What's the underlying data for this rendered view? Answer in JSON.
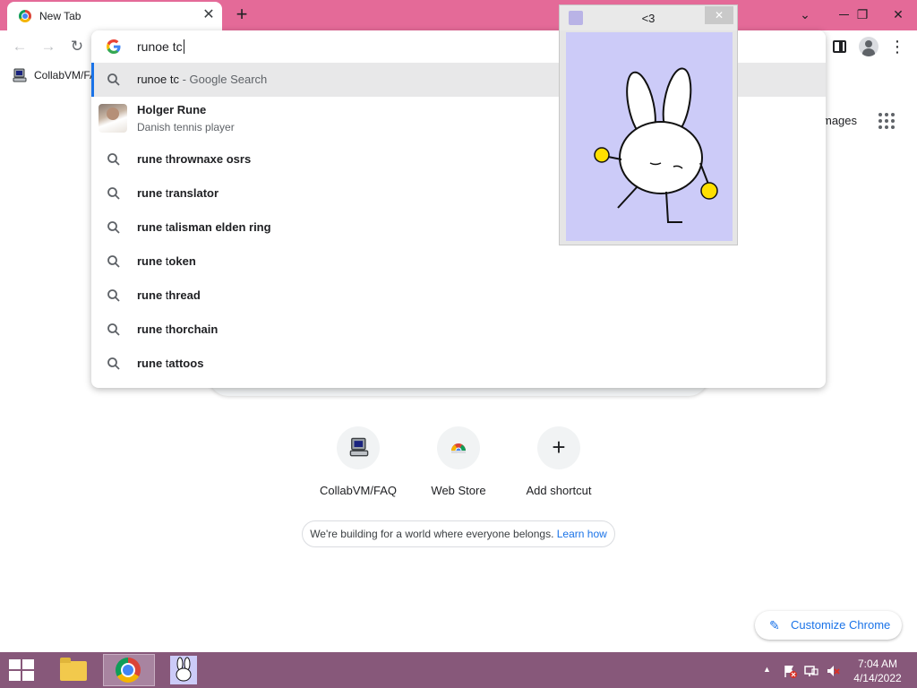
{
  "tab": {
    "title": "New Tab",
    "close_glyph": "✕",
    "new_tab_glyph": "+"
  },
  "window_controls": {
    "minimize": "⌄",
    "restore": "❐",
    "close": "✕"
  },
  "toolbar": {
    "back": "←",
    "forward": "→",
    "reload": "↻",
    "menu": "⋮"
  },
  "bookmarks": [
    {
      "label": "CollabVM/FAQ",
      "icon": "collabvm-computer-icon"
    }
  ],
  "omnibox": {
    "value": "runoe tc",
    "search_suffix": " - Google Search",
    "entity": {
      "title": "Holger Rune",
      "subtitle": "Danish tennis player"
    },
    "suggestions": [
      {
        "prefix": "rune ",
        "typed": "t",
        "rest": "hrownaxe osrs"
      },
      {
        "prefix": "rune ",
        "typed": "t",
        "rest": "ranslator"
      },
      {
        "prefix": "rune ",
        "typed": "t",
        "rest": "alisman elden ring"
      },
      {
        "prefix": "rune ",
        "typed": "t",
        "rest": "oken"
      },
      {
        "prefix": "rune ",
        "typed": "t",
        "rest": "hread"
      },
      {
        "prefix": "rune ",
        "typed": "t",
        "rest": "horchain"
      },
      {
        "prefix": "rune ",
        "typed": "t",
        "rest": "attoos"
      }
    ]
  },
  "ntp": {
    "images_link": "mages",
    "shortcuts": [
      {
        "label": "CollabVM/FAQ",
        "icon": "collabvm-computer-icon"
      },
      {
        "label": "Web Store",
        "icon": "web-store-icon"
      },
      {
        "label": "Add shortcut",
        "icon": "plus-icon",
        "glyph": "+"
      }
    ],
    "promo": {
      "text": "We're building for a world where everyone belongs. ",
      "link": "Learn how"
    },
    "customize": {
      "icon": "✎",
      "label": "Customize Chrome"
    }
  },
  "popup": {
    "title": "<3",
    "close_glyph": "✕",
    "image": "dancing-bunny"
  },
  "taskbar": {
    "items": [
      {
        "name": "file-explorer",
        "icon": "folder-icon"
      },
      {
        "name": "chrome",
        "icon": "chrome-icon",
        "active": true
      },
      {
        "name": "bunny-app",
        "icon": "bunny-icon"
      }
    ],
    "tray_arrow": "▲",
    "tray_icons": [
      "action-center-flag-icon",
      "network-icon",
      "volume-muted-icon"
    ],
    "time": "7:04 AM",
    "date": "4/14/2022"
  },
  "colors": {
    "titlebar": "#e46a98",
    "taskbar": "#87587a",
    "accent_blue": "#1a73e8",
    "popup_background": "#cccbf8",
    "selected_row": "#e8e8e9"
  }
}
